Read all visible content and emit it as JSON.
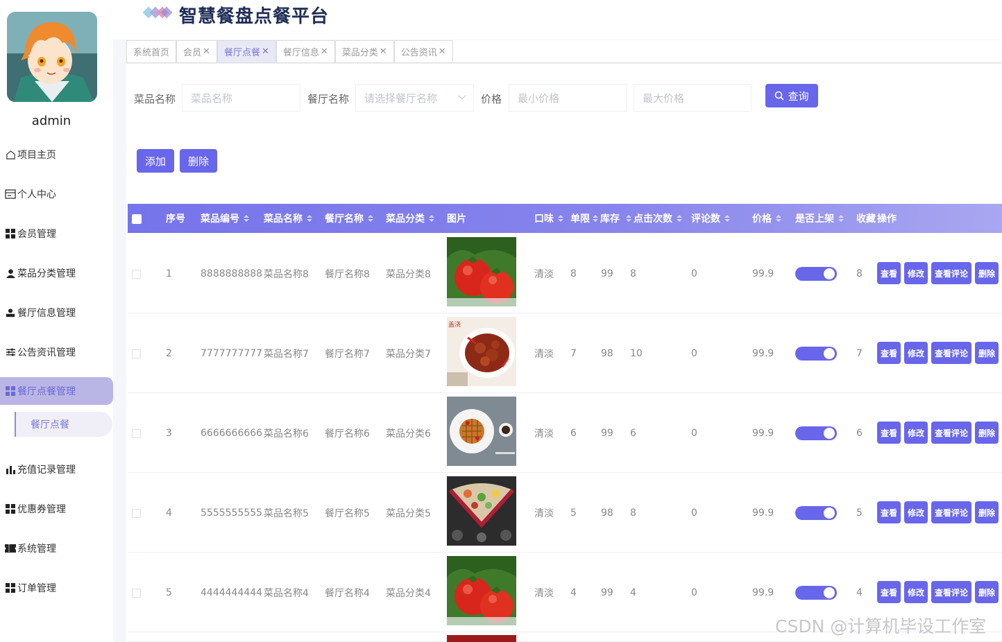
{
  "app": {
    "title": "智慧餐盘点餐平台"
  },
  "user": {
    "name": "admin"
  },
  "sidebar": {
    "items": [
      {
        "label": "项目主页",
        "icon": "home-icon"
      },
      {
        "label": "个人中心",
        "icon": "id-card-icon"
      },
      {
        "label": "会员管理",
        "icon": "grid-icon"
      },
      {
        "label": "菜品分类管理",
        "icon": "user-icon"
      },
      {
        "label": "餐厅信息管理",
        "icon": "person-icon"
      },
      {
        "label": "公告资讯管理",
        "icon": "sliders-icon"
      },
      {
        "label": "餐厅点餐管理",
        "icon": "grid-icon",
        "active": true
      },
      {
        "label": "充值记录管理",
        "icon": "bar-chart-icon"
      },
      {
        "label": "优惠券管理",
        "icon": "grid-icon"
      },
      {
        "label": "系统管理",
        "icon": "ticket-icon"
      },
      {
        "label": "订单管理",
        "icon": "grid-icon"
      }
    ],
    "submenu": {
      "label": "餐厅点餐"
    }
  },
  "tabs": [
    {
      "label": "系统首页",
      "closable": false
    },
    {
      "label": "会员",
      "closable": true
    },
    {
      "label": "餐厅点餐",
      "closable": true,
      "active": true
    },
    {
      "label": "餐厅信息",
      "closable": true
    },
    {
      "label": "菜品分类",
      "closable": true
    },
    {
      "label": "公告资讯",
      "closable": true
    }
  ],
  "search": {
    "dish_name_label": "菜品名称",
    "dish_name_placeholder": "菜品名称",
    "restaurant_label": "餐厅名称",
    "restaurant_placeholder": "请选择餐厅名称",
    "price_label": "价格",
    "min_price_placeholder": "最小价格",
    "max_price_placeholder": "最大价格",
    "query_button": "查询"
  },
  "toolbar": {
    "add_button": "添加",
    "delete_button": "删除"
  },
  "table": {
    "headers": {
      "index": "序号",
      "code": "菜品编号",
      "name": "菜品名称",
      "restaurant": "餐厅名称",
      "category": "菜品分类",
      "image": "图片",
      "taste": "口味",
      "limit": "单限",
      "stock": "库存",
      "clicks": "点击次数",
      "comments": "评论数",
      "price": "价格",
      "on_shelf": "是否上架",
      "favorites": "收藏",
      "actions": "操作"
    },
    "action_labels": {
      "view": "查看",
      "edit": "修改",
      "view_comments": "查看评论",
      "delete": "删除"
    },
    "rows": [
      {
        "index": "1",
        "code": "8888888888",
        "name": "菜品名称8",
        "restaurant": "餐厅名称8",
        "category": "菜品分类8",
        "image": "tomato",
        "taste": "清淡",
        "limit": "8",
        "stock": "99",
        "clicks": "8",
        "comments": "0",
        "price": "99.9",
        "on_shelf": true,
        "favorites": "8"
      },
      {
        "index": "2",
        "code": "7777777777",
        "name": "菜品名称7",
        "restaurant": "餐厅名称7",
        "category": "菜品分类7",
        "image": "chicken",
        "image_caption": "盖浇",
        "taste": "清淡",
        "limit": "7",
        "stock": "98",
        "clicks": "10",
        "comments": "0",
        "price": "99.9",
        "on_shelf": true,
        "favorites": "7"
      },
      {
        "index": "3",
        "code": "6666666666",
        "name": "菜品名称6",
        "restaurant": "餐厅名称6",
        "category": "菜品分类6",
        "image": "waffle",
        "taste": "清淡",
        "limit": "6",
        "stock": "99",
        "clicks": "6",
        "comments": "0",
        "price": "99.9",
        "on_shelf": true,
        "favorites": "6"
      },
      {
        "index": "4",
        "code": "5555555555",
        "name": "菜品名称5",
        "restaurant": "餐厅名称5",
        "category": "菜品分类5",
        "image": "platter",
        "taste": "清淡",
        "limit": "5",
        "stock": "98",
        "clicks": "8",
        "comments": "0",
        "price": "99.9",
        "on_shelf": true,
        "favorites": "5"
      },
      {
        "index": "5",
        "code": "4444444444",
        "name": "菜品名称4",
        "restaurant": "餐厅名称4",
        "category": "菜品分类4",
        "image": "tomato",
        "taste": "清淡",
        "limit": "4",
        "stock": "99",
        "clicks": "4",
        "comments": "0",
        "price": "99.9",
        "on_shelf": true,
        "favorites": "4"
      }
    ]
  },
  "watermark": "CSDN @计算机毕设工作室",
  "colors": {
    "accent": "#6866ea",
    "sidebar_active_bg": "#b9b6e6",
    "title": "#1f2d56"
  }
}
